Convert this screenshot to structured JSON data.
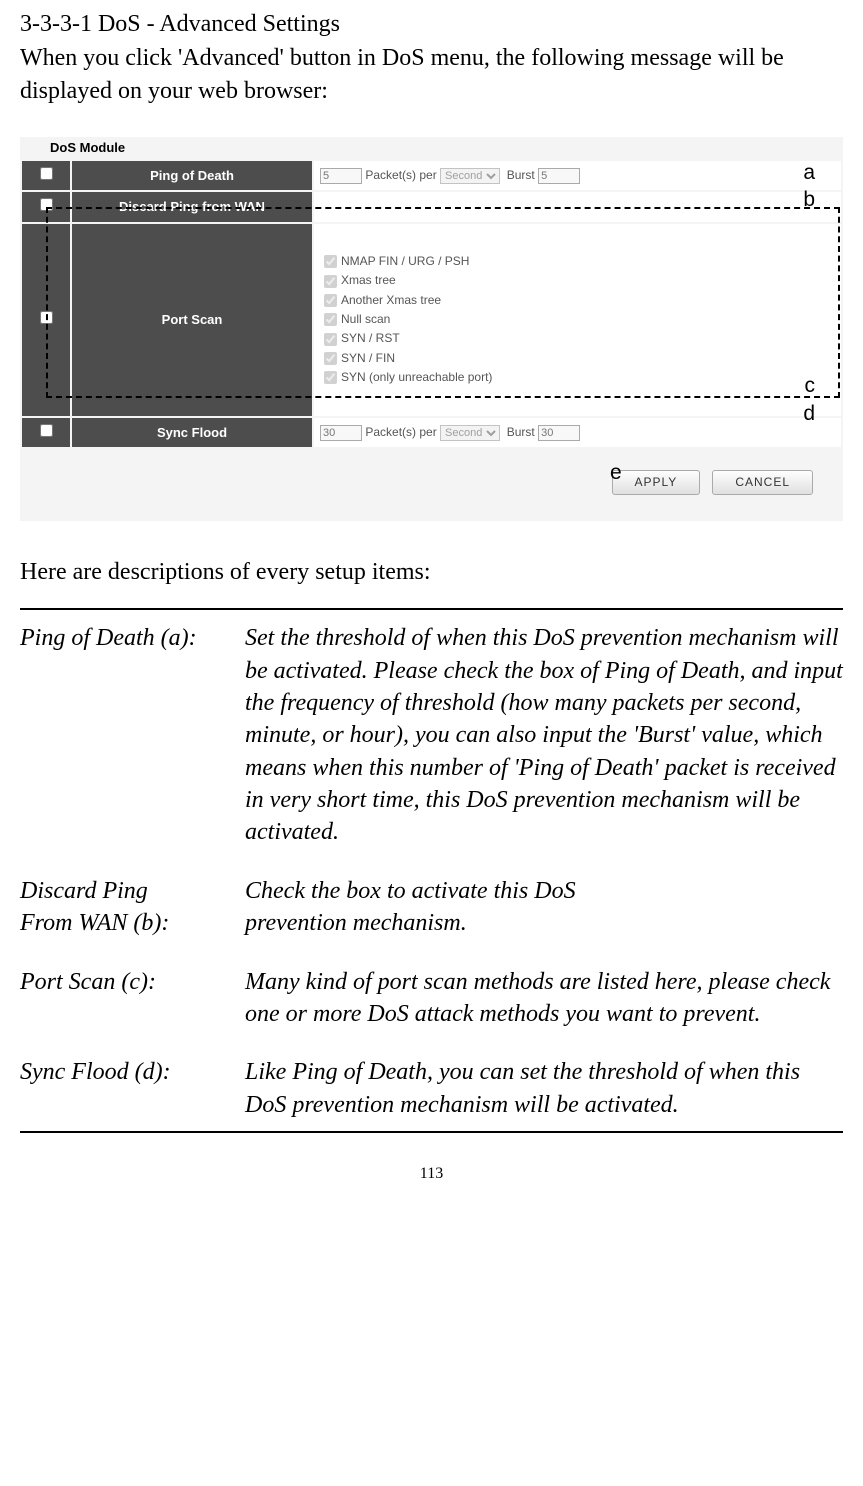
{
  "heading": "3-3-3-1 DoS - Advanced Settings",
  "intro": "When you click 'Advanced' button in DoS menu, the following message will be displayed on your web browser:",
  "module_title": "DoS Module",
  "rows": {
    "ping_of_death": {
      "label": "Ping of Death",
      "packet_value": "5",
      "packet_text": "Packet(s) per",
      "unit": "Second",
      "burst_text": "Burst",
      "burst_value": "5"
    },
    "discard_ping": {
      "label": "Discard Ping from WAN"
    },
    "port_scan": {
      "label": "Port Scan",
      "options": [
        "NMAP FIN / URG / PSH",
        "Xmas tree",
        "Another Xmas tree",
        "Null scan",
        "SYN / RST",
        "SYN / FIN",
        "SYN (only unreachable port)"
      ]
    },
    "sync_flood": {
      "label": "Sync Flood",
      "packet_value": "30",
      "packet_text": "Packet(s) per",
      "unit": "Second",
      "burst_text": "Burst",
      "burst_value": "30"
    }
  },
  "markers": {
    "a": "a",
    "b": "b",
    "c": "c",
    "d": "d",
    "e": "e"
  },
  "buttons": {
    "apply": "APPLY",
    "cancel": "CANCEL"
  },
  "desc_intro": "Here are descriptions of every setup items:",
  "defs": {
    "ping_of_death": {
      "label": "Ping of Death (a):",
      "text": "Set the threshold of when this DoS prevention mechanism will be activated. Please check the box of Ping of Death, and input the frequency of threshold (how many packets per second, minute, or hour), you can also input the 'Burst' value, which means when this number of 'Ping of Death' packet is received in very short time, this DoS prevention mechanism will be activated."
    },
    "discard_ping": {
      "label1": "Discard Ping",
      "label2": "From WAN (b):",
      "text1": "Check the box to activate this DoS",
      "text2": "prevention mechanism."
    },
    "port_scan": {
      "label": "Port Scan (c):",
      "text": "Many kind of port scan methods are listed here, please check one or more DoS attack methods you want to prevent."
    },
    "sync_flood": {
      "label": "Sync Flood (d):",
      "text": "Like Ping of Death, you can set the threshold of when this DoS prevention mechanism will be activated."
    }
  },
  "page_number": "113"
}
